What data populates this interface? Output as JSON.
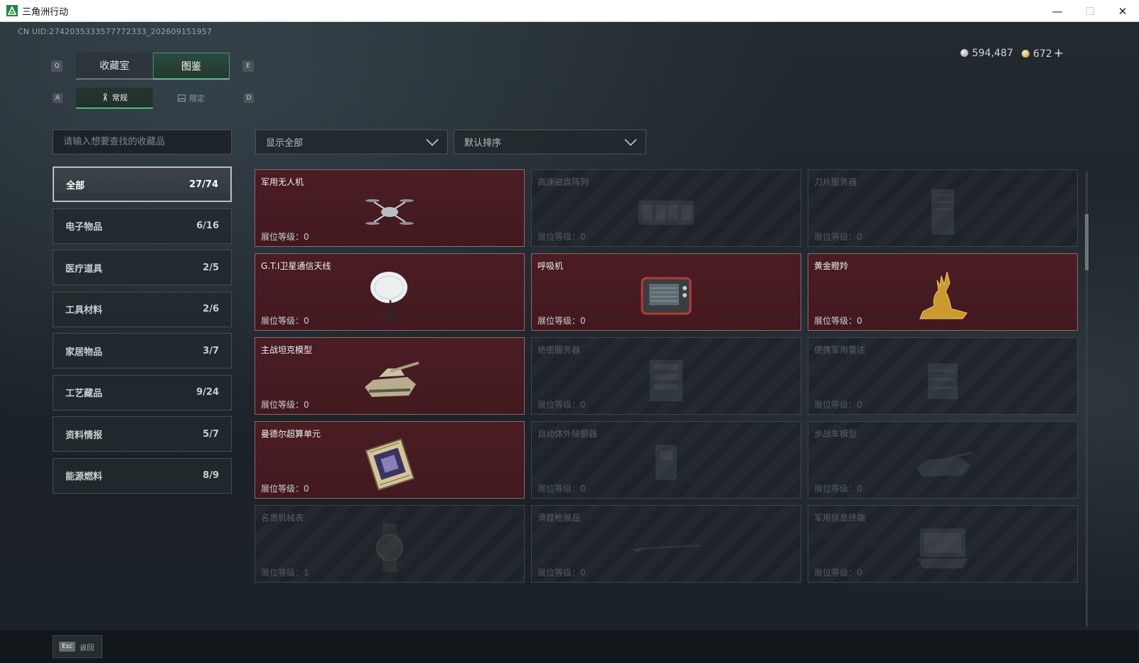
{
  "window": {
    "title": "三角洲行动",
    "minimize": "—",
    "maximize": "☐",
    "close": "✕"
  },
  "uid": "CN UID:2742035333577772333_202609151957",
  "currency": {
    "silver": "594,487",
    "gold": "672",
    "plus": "+"
  },
  "keys": {
    "q": "Q",
    "e": "E",
    "a": "A",
    "d": "D"
  },
  "main_tabs": [
    {
      "label": "收藏室",
      "active": false
    },
    {
      "label": "图鉴",
      "active": true
    }
  ],
  "sub_tabs": [
    {
      "label": "常规",
      "icon": "figure-icon",
      "active": true
    },
    {
      "label": "限定",
      "icon": "image-icon",
      "active": false
    }
  ],
  "search": {
    "placeholder": "请输入想要查找的收藏品"
  },
  "filter": {
    "value": "显示全部"
  },
  "sort": {
    "value": "默认排序"
  },
  "categories": [
    {
      "label": "全部",
      "count": "27/74",
      "active": true
    },
    {
      "label": "电子物品",
      "count": "6/16"
    },
    {
      "label": "医疗道具",
      "count": "2/5"
    },
    {
      "label": "工具材料",
      "count": "2/6"
    },
    {
      "label": "家居物品",
      "count": "3/7"
    },
    {
      "label": "工艺藏品",
      "count": "9/24"
    },
    {
      "label": "资料情报",
      "count": "5/7"
    },
    {
      "label": "能源燃料",
      "count": "8/9"
    }
  ],
  "level_label": "展位等级：",
  "items": [
    {
      "name": "军用无人机",
      "level": "0",
      "owned": true,
      "icon": "drone-icon"
    },
    {
      "name": "高速磁盘阵列",
      "level": "0",
      "owned": false,
      "icon": "disk-array-icon"
    },
    {
      "name": "刀片服务器",
      "level": "0",
      "owned": false,
      "icon": "blade-server-icon"
    },
    {
      "name": "G.T.I卫星通信天线",
      "level": "0",
      "owned": true,
      "icon": "satellite-dish-icon"
    },
    {
      "name": "呼吸机",
      "level": "0",
      "owned": true,
      "icon": "ventilator-icon"
    },
    {
      "name": "黄金瞪羚",
      "level": "0",
      "owned": true,
      "icon": "golden-gazelle-icon"
    },
    {
      "name": "主战坦克模型",
      "level": "0",
      "owned": true,
      "icon": "tank-model-icon"
    },
    {
      "name": "绝密服务器",
      "level": "0",
      "owned": false,
      "icon": "server-icon"
    },
    {
      "name": "便携军用雷达",
      "level": "0",
      "owned": false,
      "icon": "radar-icon"
    },
    {
      "name": "曼德尔超算单元",
      "level": "0",
      "owned": true,
      "icon": "supercompute-unit-icon"
    },
    {
      "name": "自动体外除颤器",
      "level": "0",
      "owned": false,
      "icon": "defibrillator-icon"
    },
    {
      "name": "步战车模型",
      "level": "0",
      "owned": false,
      "icon": "ifv-model-icon"
    },
    {
      "name": "名贵机械表",
      "level": "1",
      "owned": false,
      "icon": "watch-icon"
    },
    {
      "name": "滑膛枪展品",
      "level": "0",
      "owned": false,
      "icon": "musket-icon"
    },
    {
      "name": "军用信息终端",
      "level": "0",
      "owned": false,
      "icon": "terminal-icon"
    }
  ],
  "back": {
    "key": "Esc",
    "label": "返回"
  },
  "colors": {
    "owned_card": "#4a1d23",
    "active_tab": "#55c597",
    "titlebar": "#ffffff"
  }
}
